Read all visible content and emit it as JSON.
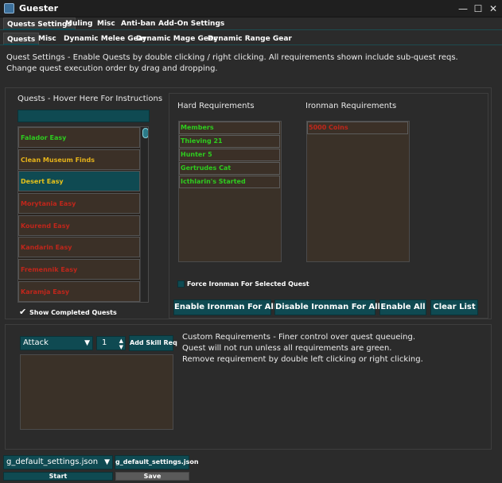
{
  "window": {
    "title": "Guester",
    "minimize": "—",
    "maximize": "☐",
    "close": "✕"
  },
  "main_tabs": [
    "Quests Settings",
    "Muling",
    "Misc",
    "Anti-ban",
    "Add-On Settings"
  ],
  "sub_tabs": [
    "Quests",
    "Misc",
    "Dynamic Melee Gear",
    "Dynamic Mage Gear",
    "Dynamic Range Gear"
  ],
  "description": {
    "line1": "Quest Settings - Enable Quests by double clicking / right clicking. All requirements shown include sub-quest reqs.",
    "line2": "Change quest execution order by drag and dropping."
  },
  "quests_panel": {
    "title": "Quests - Hover Here For Instructions",
    "search_value": "",
    "items": [
      {
        "label": "Falador Easy",
        "color": "#2ecc1f"
      },
      {
        "label": "Clean Museum Finds",
        "color": "#e6b31a"
      },
      {
        "label": "Desert Easy",
        "color": "#e6c21a"
      },
      {
        "label": "Morytania Easy",
        "color": "#c0261b"
      },
      {
        "label": "Kourend Easy",
        "color": "#c0261b"
      },
      {
        "label": "Kandarin Easy",
        "color": "#c0261b"
      },
      {
        "label": "Fremennik Easy",
        "color": "#c0261b"
      },
      {
        "label": "Karamja Easy",
        "color": "#c0261b"
      }
    ],
    "show_completed_label": "Show Completed Quests",
    "show_completed_checked": true
  },
  "hard_requirements": {
    "title": "Hard Requirements",
    "items": [
      {
        "label": "Members",
        "color": "#2ecc1f"
      },
      {
        "label": "Thieving 21",
        "color": "#2ecc1f"
      },
      {
        "label": "Hunter 5",
        "color": "#2ecc1f"
      },
      {
        "label": "Gertrudes Cat",
        "color": "#2ecc1f"
      },
      {
        "label": "Icthlarin's Started",
        "color": "#2ecc1f"
      }
    ]
  },
  "ironman_requirements": {
    "title": "Ironman Requirements",
    "items": [
      {
        "label": "5000 Coins",
        "color": "#c0261b"
      }
    ]
  },
  "force_ironman": {
    "label": "Force Ironman For Selected Quest",
    "checked": false
  },
  "buttons": {
    "enable_ironman_all": "Enable Ironman For All",
    "disable_ironman_all": "Disable Ironman For All",
    "enable_all": "Enable All",
    "clear_list": "Clear List"
  },
  "custom_requirements": {
    "skill_selected": "Attack",
    "level_value": "1",
    "add_skill_req": "Add Skill Req",
    "help_line1": "Custom Requirements - Finer control over quest queueing.",
    "help_line2": "Quest will not run unless all requirements are green.",
    "help_line3": "Remove requirement by double left clicking or right clicking."
  },
  "footer": {
    "settings_file_selected": "g_default_settings.json",
    "settings_file_field": "g_default_settings.json",
    "start": "Start",
    "save": "Save"
  },
  "colors": {
    "accent_teal": "#0f4a52",
    "list_bg": "#3b3027",
    "ok_green": "#2ecc1f",
    "fail_red": "#c0261b",
    "warn_yellow": "#e6b31a"
  }
}
